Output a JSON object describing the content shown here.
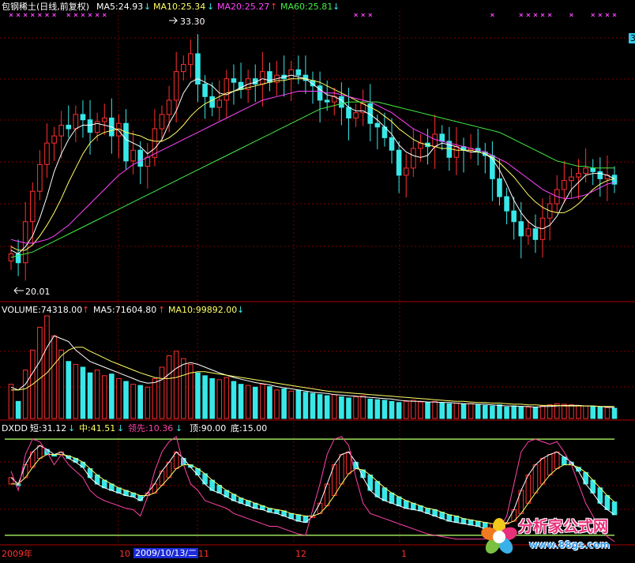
{
  "stock": {
    "name": "包钢稀土(日线,前复权)"
  },
  "price_panel": {
    "ma5": "MA5:24.93",
    "ma5_arrow": "↓",
    "ma10": "MA10:25.34",
    "ma10_arrow": "↓",
    "ma20": "MA20:25.27",
    "ma20_arrow": "↑",
    "ma60": "MA60:25.81",
    "ma60_arrow": "↓",
    "high_label": "33.30",
    "low_label": "20.01",
    "right_edge_tick": "3"
  },
  "volume_panel": {
    "volume": "VOLUME:74318.00",
    "volume_arrow": "↑",
    "ma5": "MA5:71604.80",
    "ma5_arrow": "↑",
    "ma10": "MA10:99892.00",
    "ma10_arrow": "↓"
  },
  "dxdd_panel": {
    "name": "DXDD",
    "short": "短:31.12",
    "short_arrow": "↓",
    "mid": "中:41.51",
    "mid_arrow": "↓",
    "lead": "领先:10.36",
    "lead_arrow": "↓",
    "top": "顶:90.00",
    "bottom": "底:15.00"
  },
  "time_axis": {
    "labels": [
      "2009年",
      "10",
      "2009/10/13/二",
      "11",
      "12",
      "1"
    ]
  },
  "watermark": {
    "text": "分析家公式网",
    "url": "www.88gs.com"
  },
  "colors": {
    "up": "#ff3030",
    "down": "#38e8e8",
    "background": "#000000",
    "ma5": "#ffffff",
    "ma10": "#ffff66",
    "ma20": "#ff44ff",
    "ma60": "#44ee44",
    "grid": "#7a0000",
    "panel_border": "#b00000"
  },
  "chart_data": [
    {
      "type": "candlestick",
      "title": "包钢稀土(日线,前复权)",
      "ylim": [
        18.5,
        34.5
      ],
      "annotations": [
        {
          "label": "33.30",
          "value": 33.3
        },
        {
          "label": "20.01",
          "value": 20.01
        }
      ],
      "closes": [
        21.0,
        20.5,
        22.8,
        24.5,
        26.0,
        27.2,
        27.6,
        28.2,
        28.0,
        28.8,
        28.5,
        27.8,
        28.4,
        28.6,
        27.6,
        28.3,
        26.2,
        26.8,
        25.9,
        26.4,
        28.0,
        28.8,
        29.6,
        31.2,
        31.6,
        32.2,
        30.5,
        29.8,
        29.2,
        29.6,
        30.8,
        30.6,
        30.2,
        30.8,
        30.5,
        31.2,
        30.6,
        31.0,
        30.8,
        31.3,
        31.0,
        30.7,
        30.4,
        29.6,
        29.5,
        29.8,
        29.2,
        28.6,
        28.9,
        29.4,
        28.3,
        28.1,
        27.5,
        26.8,
        25.4,
        25.8,
        26.9,
        27.2,
        27.0,
        27.7,
        27.3,
        26.4,
        27.0,
        26.8,
        26.9,
        26.7,
        26.5,
        25.2,
        24.2,
        23.4,
        22.8,
        22.0,
        22.4,
        21.8,
        23.0,
        23.8,
        24.6,
        25.1,
        25.3,
        25.5,
        25.8,
        25.6,
        25.2,
        25.4,
        24.9
      ],
      "series": [
        {
          "name": "MA5",
          "color": "#ffffff",
          "values": [
            21.2,
            21.0,
            21.4,
            22.0,
            23.0,
            24.2,
            25.6,
            26.6,
            27.4,
            28.0,
            28.2,
            28.2,
            28.3,
            28.2,
            28.1,
            27.9,
            27.4,
            27.2,
            27.0,
            26.6,
            26.9,
            27.4,
            28.3,
            29.0,
            30.0,
            30.6,
            30.8,
            30.6,
            30.4,
            30.0,
            29.9,
            30.1,
            30.3,
            30.5,
            30.6,
            30.8,
            30.7,
            30.8,
            30.9,
            31.0,
            30.9,
            30.8,
            30.5,
            30.2,
            29.9,
            29.8,
            29.6,
            29.2,
            29.0,
            29.0,
            28.8,
            28.5,
            28.1,
            27.7,
            27.1,
            26.7,
            26.5,
            26.4,
            26.5,
            27.0,
            27.2,
            27.1,
            27.0,
            26.8,
            26.7,
            26.7,
            26.6,
            26.3,
            25.7,
            24.9,
            24.0,
            23.3,
            22.8,
            22.5,
            22.4,
            22.6,
            23.1,
            23.9,
            24.6,
            25.0,
            25.4,
            25.5,
            25.5,
            25.4,
            25.2
          ]
        },
        {
          "name": "MA10",
          "color": "#ffff66",
          "values": [
            21.4,
            21.2,
            21.2,
            21.5,
            22.0,
            22.6,
            23.3,
            24.1,
            25.0,
            25.8,
            26.6,
            27.2,
            27.6,
            27.8,
            27.9,
            28.0,
            27.8,
            27.7,
            27.6,
            27.4,
            27.3,
            27.3,
            27.5,
            27.8,
            28.2,
            28.7,
            29.1,
            29.4,
            29.6,
            29.8,
            30.0,
            30.1,
            30.2,
            30.3,
            30.4,
            30.5,
            30.6,
            30.7,
            30.7,
            30.8,
            30.8,
            30.8,
            30.7,
            30.6,
            30.4,
            30.2,
            30.0,
            29.8,
            29.6,
            29.4,
            29.2,
            29.0,
            28.7,
            28.4,
            28.0,
            27.7,
            27.4,
            27.2,
            27.1,
            27.0,
            26.9,
            26.9,
            26.8,
            26.8,
            26.8,
            26.7,
            26.6,
            26.4,
            26.1,
            25.7,
            25.3,
            24.8,
            24.3,
            23.9,
            23.6,
            23.4,
            23.3,
            23.3,
            23.5,
            23.8,
            24.2,
            24.6,
            24.9,
            25.1,
            25.2
          ]
        },
        {
          "name": "MA20",
          "color": "#ff44ff",
          "values": [
            21.8,
            21.7,
            21.6,
            21.6,
            21.7,
            21.8,
            22.0,
            22.3,
            22.6,
            23.0,
            23.4,
            23.8,
            24.2,
            24.6,
            25.0,
            25.4,
            25.7,
            26.0,
            26.2,
            26.4,
            26.6,
            26.8,
            27.0,
            27.2,
            27.4,
            27.6,
            27.8,
            28.0,
            28.2,
            28.4,
            28.6,
            28.8,
            29.0,
            29.2,
            29.4,
            29.6,
            29.7,
            29.8,
            29.9,
            30.0,
            30.1,
            30.1,
            30.1,
            30.1,
            30.0,
            30.0,
            29.9,
            29.8,
            29.7,
            29.6,
            29.5,
            29.3,
            29.1,
            28.9,
            28.6,
            28.3,
            28.0,
            27.8,
            27.6,
            27.4,
            27.3,
            27.2,
            27.1,
            27.0,
            26.9,
            26.8,
            26.7,
            26.5,
            26.3,
            26.1,
            25.8,
            25.5,
            25.2,
            24.9,
            24.6,
            24.4,
            24.2,
            24.1,
            24.1,
            24.2,
            24.3,
            24.5,
            24.7,
            24.9,
            25.0
          ]
        },
        {
          "name": "MA60",
          "color": "#44ee44",
          "values": [
            20.8,
            20.9,
            21.0,
            21.1,
            21.3,
            21.5,
            21.7,
            21.9,
            22.1,
            22.3,
            22.5,
            22.7,
            22.9,
            23.1,
            23.3,
            23.5,
            23.7,
            23.9,
            24.1,
            24.3,
            24.5,
            24.7,
            24.9,
            25.1,
            25.3,
            25.5,
            25.7,
            25.9,
            26.1,
            26.3,
            26.5,
            26.7,
            26.9,
            27.1,
            27.3,
            27.5,
            27.7,
            27.9,
            28.1,
            28.3,
            28.5,
            28.7,
            28.9,
            29.1,
            29.2,
            29.3,
            29.4,
            29.5,
            29.5,
            29.5,
            29.5,
            29.5,
            29.4,
            29.3,
            29.2,
            29.1,
            29.0,
            28.9,
            28.8,
            28.7,
            28.6,
            28.5,
            28.4,
            28.3,
            28.2,
            28.1,
            28.0,
            27.9,
            27.8,
            27.6,
            27.4,
            27.2,
            27.0,
            26.8,
            26.6,
            26.4,
            26.2,
            26.1,
            26.0,
            25.9,
            25.9,
            25.8,
            25.8,
            25.8,
            25.8
          ]
        }
      ]
    },
    {
      "type": "bar",
      "title": "VOLUME",
      "values": [
        60,
        30,
        85,
        120,
        160,
        180,
        145,
        120,
        100,
        95,
        90,
        80,
        85,
        75,
        78,
        70,
        65,
        60,
        58,
        55,
        70,
        90,
        110,
        118,
        105,
        95,
        80,
        75,
        70,
        68,
        72,
        65,
        60,
        58,
        55,
        60,
        56,
        50,
        52,
        48,
        50,
        46,
        44,
        42,
        40,
        42,
        38,
        36,
        38,
        40,
        34,
        33,
        32,
        30,
        28,
        30,
        32,
        29,
        28,
        30,
        28,
        26,
        27,
        25,
        26,
        24,
        23,
        22,
        24,
        20,
        22,
        21,
        20,
        19,
        22,
        24,
        26,
        25,
        24,
        23,
        22,
        21,
        20,
        19,
        18
      ],
      "series": [
        {
          "name": "MA5",
          "values": [
            55,
            50,
            60,
            80,
            100,
            125,
            145,
            140,
            135,
            120,
            110,
            100,
            95,
            90,
            85,
            80,
            75,
            70,
            65,
            62,
            63,
            68,
            78,
            88,
            95,
            98,
            95,
            90,
            85,
            80,
            76,
            72,
            69,
            66,
            63,
            61,
            59,
            56,
            54,
            52,
            50,
            48,
            46,
            45,
            44,
            42,
            41,
            40,
            39,
            38,
            37,
            36,
            35,
            34,
            32,
            31,
            30,
            30,
            29,
            29,
            28,
            28,
            27,
            26,
            26,
            25,
            25,
            24,
            23,
            22,
            22,
            21,
            21,
            20,
            21,
            21,
            22,
            23,
            23,
            23,
            22,
            22,
            21,
            20,
            19
          ]
        },
        {
          "name": "MA10",
          "values": [
            50,
            50,
            52,
            60,
            70,
            80,
            95,
            110,
            120,
            125,
            125,
            118,
            112,
            106,
            100,
            95,
            90,
            85,
            80,
            76,
            72,
            70,
            70,
            72,
            76,
            80,
            82,
            82,
            80,
            78,
            76,
            74,
            72,
            70,
            68,
            66,
            64,
            62,
            60,
            58,
            56,
            54,
            52,
            50,
            48,
            47,
            46,
            45,
            44,
            43,
            42,
            41,
            40,
            39,
            38,
            37,
            36,
            35,
            34,
            33,
            32,
            31,
            30,
            30,
            29,
            28,
            28,
            27,
            27,
            26,
            25,
            25,
            24,
            24,
            23,
            23,
            23,
            22,
            22,
            22,
            22,
            22,
            21,
            21,
            21
          ]
        }
      ]
    },
    {
      "type": "line",
      "title": "DXDD",
      "ylim": [
        10,
        95
      ],
      "reference_lines": [
        {
          "label": "顶",
          "value": 90
        },
        {
          "label": "底",
          "value": 15
        }
      ],
      "series": [
        {
          "name": "短",
          "color": "#ffffff",
          "values": [
            60,
            55,
            70,
            80,
            85,
            82,
            78,
            80,
            75,
            72,
            68,
            60,
            55,
            52,
            50,
            48,
            46,
            45,
            42,
            48,
            55,
            65,
            72,
            80,
            75,
            68,
            62,
            55,
            50,
            48,
            45,
            42,
            40,
            38,
            36,
            35,
            33,
            32,
            30,
            28,
            26,
            25,
            30,
            40,
            55,
            70,
            78,
            80,
            72,
            60,
            50,
            45,
            42,
            40,
            38,
            36,
            35,
            34,
            32,
            30,
            28,
            26,
            25,
            24,
            23,
            22,
            20,
            20,
            22,
            25,
            35,
            50,
            62,
            70,
            75,
            78,
            80,
            76,
            72,
            65,
            55,
            48,
            40,
            35,
            31
          ]
        },
        {
          "name": "中",
          "color": "#ffff66",
          "values": [
            55,
            55,
            60,
            68,
            75,
            78,
            78,
            78,
            77,
            75,
            72,
            67,
            62,
            58,
            55,
            52,
            50,
            48,
            46,
            46,
            48,
            54,
            60,
            67,
            70,
            70,
            67,
            63,
            58,
            54,
            50,
            47,
            44,
            42,
            40,
            38,
            36,
            35,
            34,
            32,
            31,
            30,
            30,
            32,
            38,
            46,
            55,
            63,
            67,
            66,
            62,
            57,
            52,
            48,
            45,
            42,
            40,
            38,
            36,
            35,
            33,
            31,
            30,
            28,
            27,
            26,
            25,
            24,
            24,
            24,
            26,
            32,
            40,
            48,
            55,
            62,
            67,
            70,
            70,
            68,
            64,
            58,
            52,
            46,
            41
          ]
        },
        {
          "name": "领先",
          "color": "#ff44aa",
          "values": [
            65,
            50,
            78,
            90,
            88,
            80,
            70,
            78,
            70,
            65,
            60,
            50,
            45,
            42,
            40,
            38,
            36,
            35,
            30,
            45,
            65,
            80,
            88,
            92,
            70,
            55,
            50,
            42,
            40,
            38,
            36,
            32,
            30,
            28,
            26,
            24,
            22,
            22,
            20,
            18,
            16,
            15,
            35,
            55,
            78,
            90,
            92,
            85,
            60,
            40,
            32,
            30,
            28,
            26,
            24,
            22,
            20,
            18,
            16,
            15,
            14,
            13,
            12,
            12,
            12,
            12,
            12,
            14,
            20,
            30,
            55,
            80,
            88,
            90,
            88,
            86,
            88,
            80,
            70,
            55,
            40,
            30,
            20,
            14,
            10
          ]
        }
      ]
    }
  ]
}
